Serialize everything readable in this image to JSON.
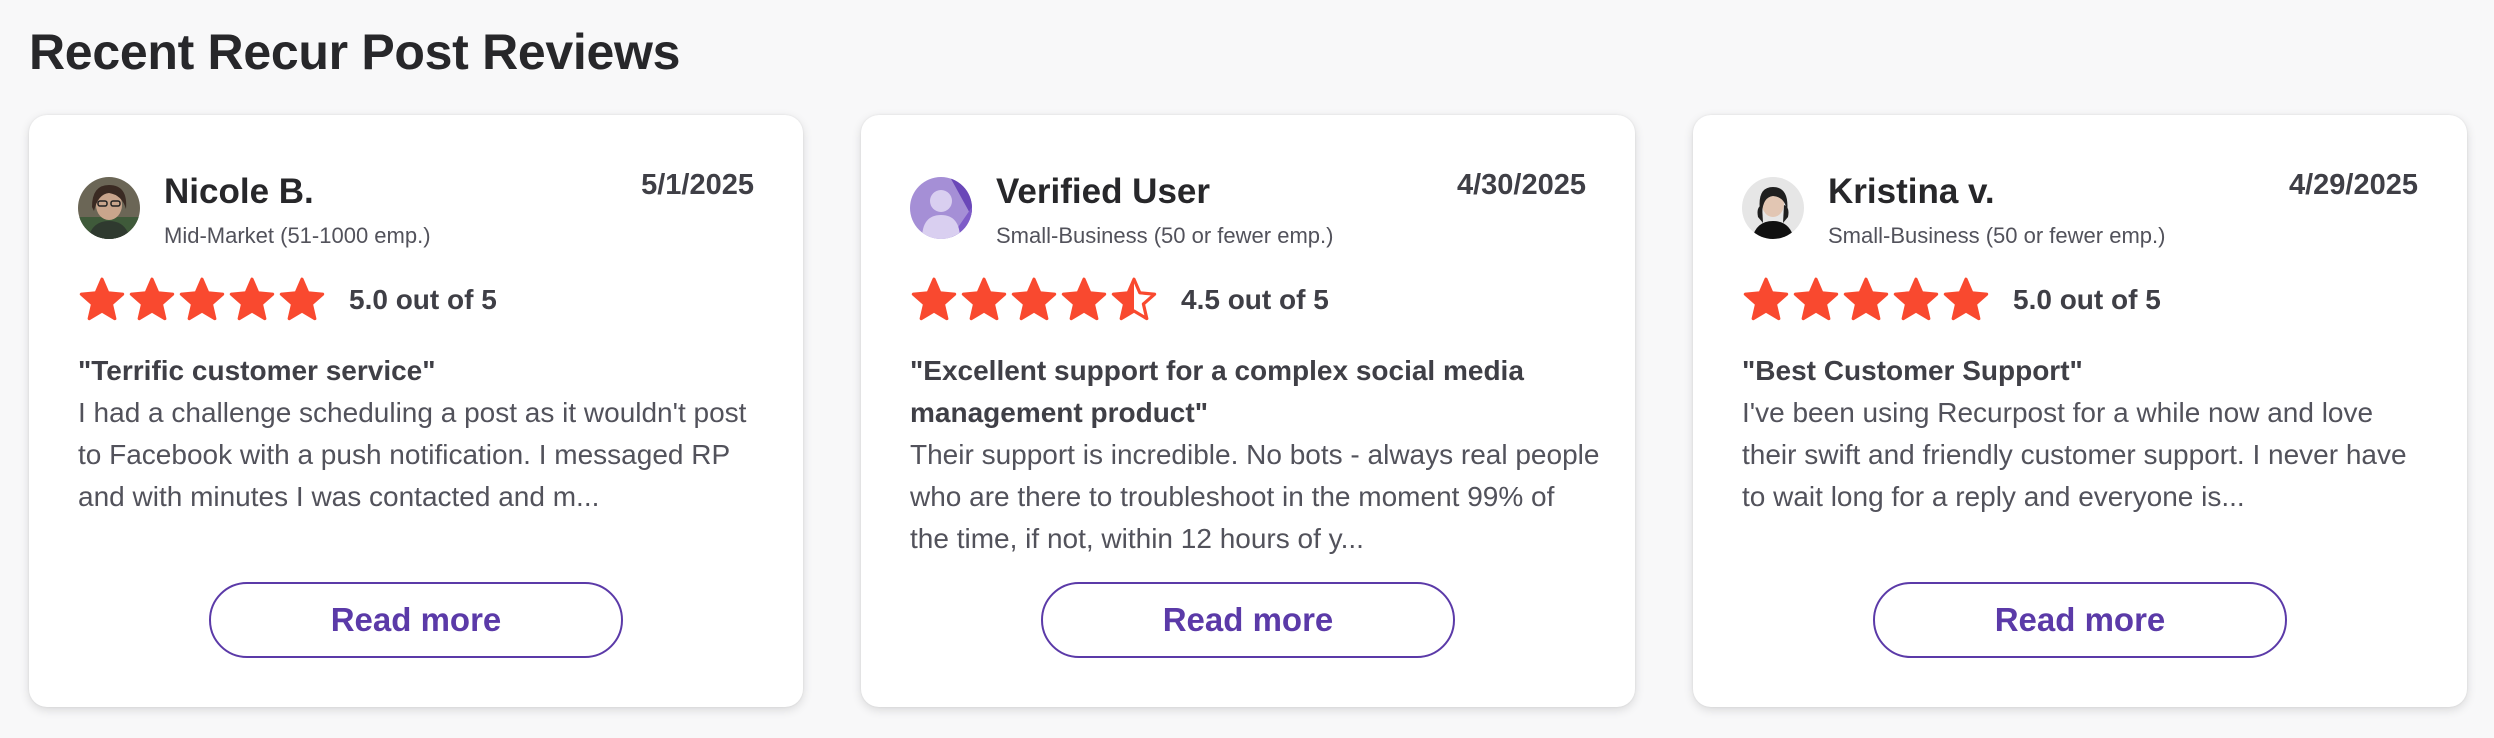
{
  "section_title": "Recent Recur Post Reviews",
  "colors": {
    "star": "#f9492f",
    "accent": "#5b3aa8"
  },
  "reviews": [
    {
      "name": "Nicole B.",
      "segment": "Mid-Market (51-1000 emp.)",
      "date": "5/1/2025",
      "rating": 5.0,
      "rating_text": "5.0 out of 5",
      "title": "\"Terrific customer service\"",
      "body": "I had a challenge scheduling a post as it wouldn't post to Facebook with a push notification. I messaged RP and with minutes I was contacted and m...",
      "read_more_label": "Read more",
      "avatar": "user-photo"
    },
    {
      "name": "Verified User",
      "segment": "Small-Business (50 or fewer emp.)",
      "date": "4/30/2025",
      "rating": 4.5,
      "rating_text": "4.5 out of 5",
      "title": "\"Excellent support for a complex social media management product\"",
      "body": "Their support is incredible. No bots - always real people who are there to troubleshoot in the moment 99% of the time, if not, within 12 hours of y...",
      "read_more_label": "Read more",
      "avatar": "default-user-icon"
    },
    {
      "name": "Kristina v.",
      "segment": "Small-Business (50 or fewer emp.)",
      "date": "4/29/2025",
      "rating": 5.0,
      "rating_text": "5.0 out of 5",
      "title": "\"Best Customer Support\"",
      "body": "I've been using Recurpost for a while now and love their swift and friendly customer support. I never have to wait long for a reply and everyone is...",
      "read_more_label": "Read more",
      "avatar": "user-photo"
    }
  ]
}
